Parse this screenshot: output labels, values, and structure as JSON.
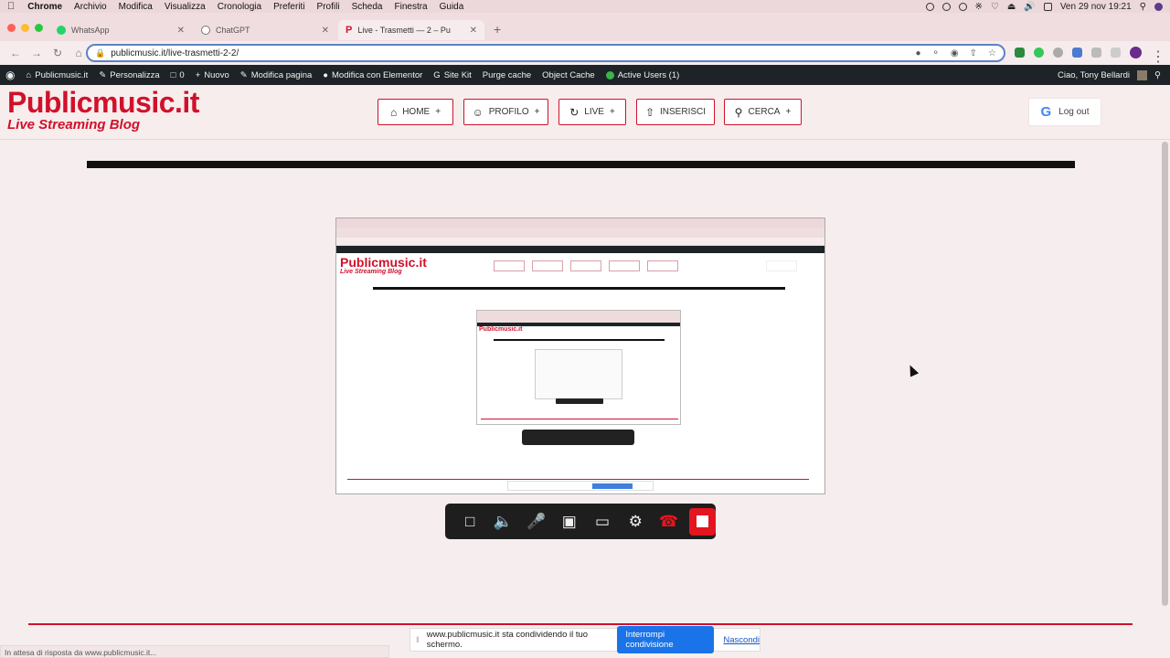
{
  "mac_menu": {
    "app": "Chrome",
    "items": [
      "Archivio",
      "Modifica",
      "Visualizza",
      "Cronologia",
      "Preferiti",
      "Profili",
      "Scheda",
      "Finestra",
      "Guida"
    ],
    "clock": "Ven 29 nov  19:21"
  },
  "tabs": [
    {
      "label": "WhatsApp",
      "color": "#25d366"
    },
    {
      "label": "ChatGPT",
      "color": "#777777"
    },
    {
      "label": "Live - Trasmetti — 2 – Pu",
      "color": "#d0112b"
    }
  ],
  "address": {
    "url": "publicmusic.it/live-trasmetti-2-2/"
  },
  "wp_bar": {
    "site": "Publicmusic.it",
    "customize": "Personalizza",
    "comments": "0",
    "new": "Nuovo",
    "edit_page": "Modifica pagina",
    "elementor": "Modifica con Elementor",
    "sitekit": "Site Kit",
    "purge": "Purge cache",
    "object_cache": "Object Cache",
    "active_users": "Active Users (1)",
    "greeting": "Ciao, Tony Bellardi"
  },
  "site": {
    "logo": "Publicmusic.it",
    "tagline": "Live Streaming Blog",
    "nav": [
      {
        "label": "HOME",
        "suffix": "+"
      },
      {
        "label": "PROFILO",
        "suffix": "+"
      },
      {
        "label": "LIVE",
        "suffix": "+"
      },
      {
        "label": "INSERISCI",
        "suffix": ""
      },
      {
        "label": "CERCA",
        "suffix": "+"
      }
    ],
    "logout": "Log out",
    "google_g": "G"
  },
  "sharebar": {
    "message": "www.publicmusic.it sta condividendo il tuo schermo.",
    "stop": "Interrompi condivisione",
    "hide": "Nascondi"
  },
  "status": "In attesa di risposta da www.publicmusic.it..."
}
